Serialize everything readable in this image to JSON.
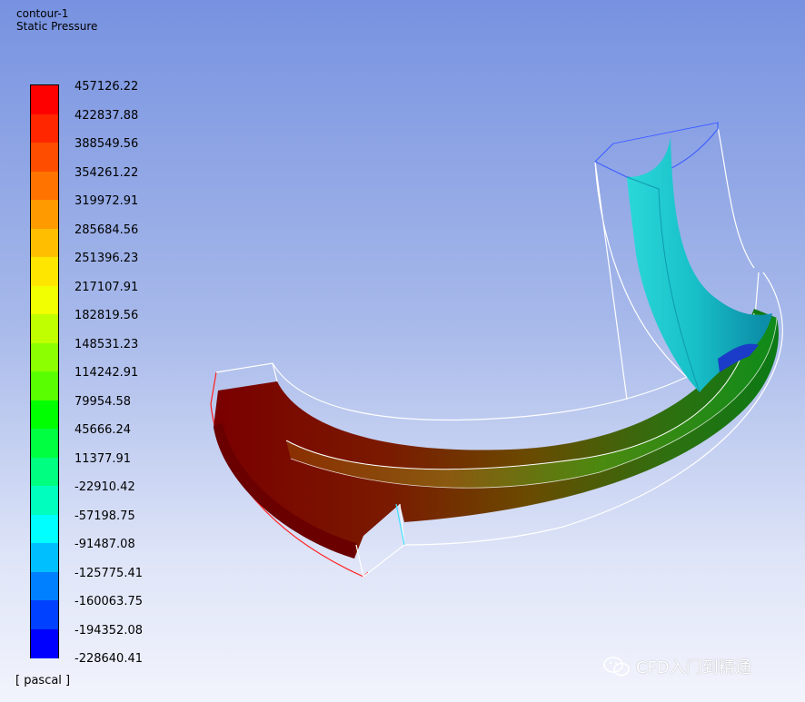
{
  "contour": {
    "name": "contour-1",
    "variable": "Static Pressure",
    "unit": "[ pascal ]",
    "levels": [
      "457126.22",
      "422837.88",
      "388549.56",
      "354261.22",
      "319972.91",
      "285684.56",
      "251396.23",
      "217107.91",
      "182819.56",
      "148531.23",
      "114242.91",
      "79954.58",
      "45666.24",
      "11377.91",
      "-22910.42",
      "-57198.75",
      "-91487.08",
      "-125775.41",
      "-160063.75",
      "-194352.08",
      "-228640.41"
    ],
    "colors": [
      "#ff0000",
      "#ff2600",
      "#ff4d00",
      "#ff7300",
      "#ff9a00",
      "#ffbf00",
      "#ffe600",
      "#f2ff00",
      "#c0ff00",
      "#8cff00",
      "#59ff00",
      "#00ff00",
      "#00ff40",
      "#00ff80",
      "#00ffbf",
      "#00ffff",
      "#00bfff",
      "#0080ff",
      "#0040ff",
      "#0000ff"
    ]
  },
  "watermark": {
    "text": "CFD入门到精通"
  }
}
